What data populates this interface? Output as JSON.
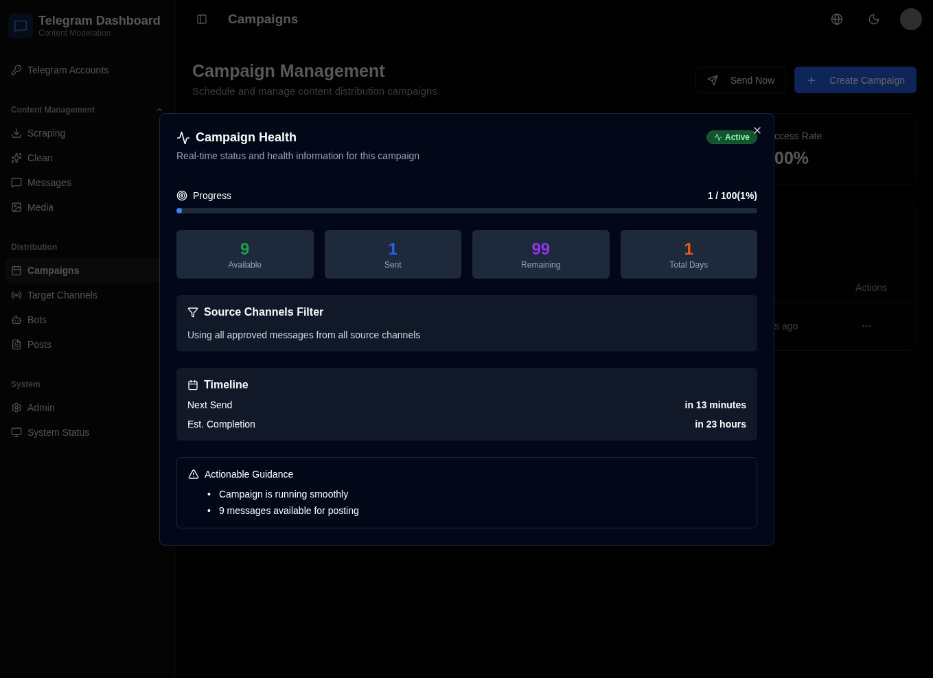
{
  "sidebar": {
    "brand": {
      "title": "Telegram Dashboard",
      "subtitle": "Content Moderation"
    },
    "top_items": [
      {
        "label": "Telegram Accounts",
        "selected": false
      }
    ],
    "sections": [
      {
        "title": "Content Management",
        "expanded": true,
        "items": [
          {
            "label": "Scraping",
            "selected": false
          },
          {
            "label": "Clean",
            "selected": false
          },
          {
            "label": "Messages",
            "selected": false
          },
          {
            "label": "Media",
            "selected": false
          }
        ]
      },
      {
        "title": "Distribution",
        "items": [
          {
            "label": "Campaigns",
            "selected": true
          },
          {
            "label": "Target Channels",
            "selected": false
          },
          {
            "label": "Bots",
            "selected": false
          },
          {
            "label": "Posts",
            "selected": false
          }
        ]
      },
      {
        "title": "System",
        "items": [
          {
            "label": "Admin",
            "selected": false
          },
          {
            "label": "System Status",
            "selected": false
          }
        ]
      }
    ]
  },
  "header": {
    "title": "Campaigns"
  },
  "page": {
    "title": "Campaign Management",
    "subtitle": "Schedule and manage content distribution campaigns",
    "buttons": [
      {
        "label": "Send Now",
        "kind": "outline"
      },
      {
        "label": "Create Campaign",
        "kind": "primary"
      }
    ],
    "stat_card": {
      "label": "ccess Rate",
      "value": "00%"
    },
    "table": {
      "columns": [
        "Actions"
      ],
      "rows": [
        {
          "cells": [
            "s ago"
          ]
        }
      ]
    }
  },
  "dialog": {
    "title": "Campaign Health",
    "description": "Real-time status and health information for this campaign",
    "badge": {
      "label": "Active"
    },
    "progress": {
      "label": "Progress",
      "reading": "1 / 100(1%)",
      "level": 0.01
    },
    "stats": [
      {
        "value": "9",
        "label": "Available",
        "color": "#16a34a"
      },
      {
        "value": "1",
        "label": "Sent",
        "color": "#2563eb"
      },
      {
        "value": "99",
        "label": "Remaining",
        "color": "#9333ea"
      },
      {
        "value": "1",
        "label": "Total Days",
        "color": "#ea580c"
      }
    ],
    "filter": {
      "title": "Source Channels Filter",
      "text": "Using all approved messages from all source channels"
    },
    "timeline": {
      "title": "Timeline",
      "rows": [
        {
          "label": "Next Send",
          "value": "in 13 minutes"
        },
        {
          "label": "Est. Completion",
          "value": "in 23 hours"
        }
      ]
    },
    "guidance": {
      "title": "Actionable Guidance",
      "items": [
        {
          "bullet": "•",
          "text": "Campaign is running smoothly"
        },
        {
          "bullet": "•",
          "text": "9 messages available for posting"
        }
      ]
    }
  }
}
